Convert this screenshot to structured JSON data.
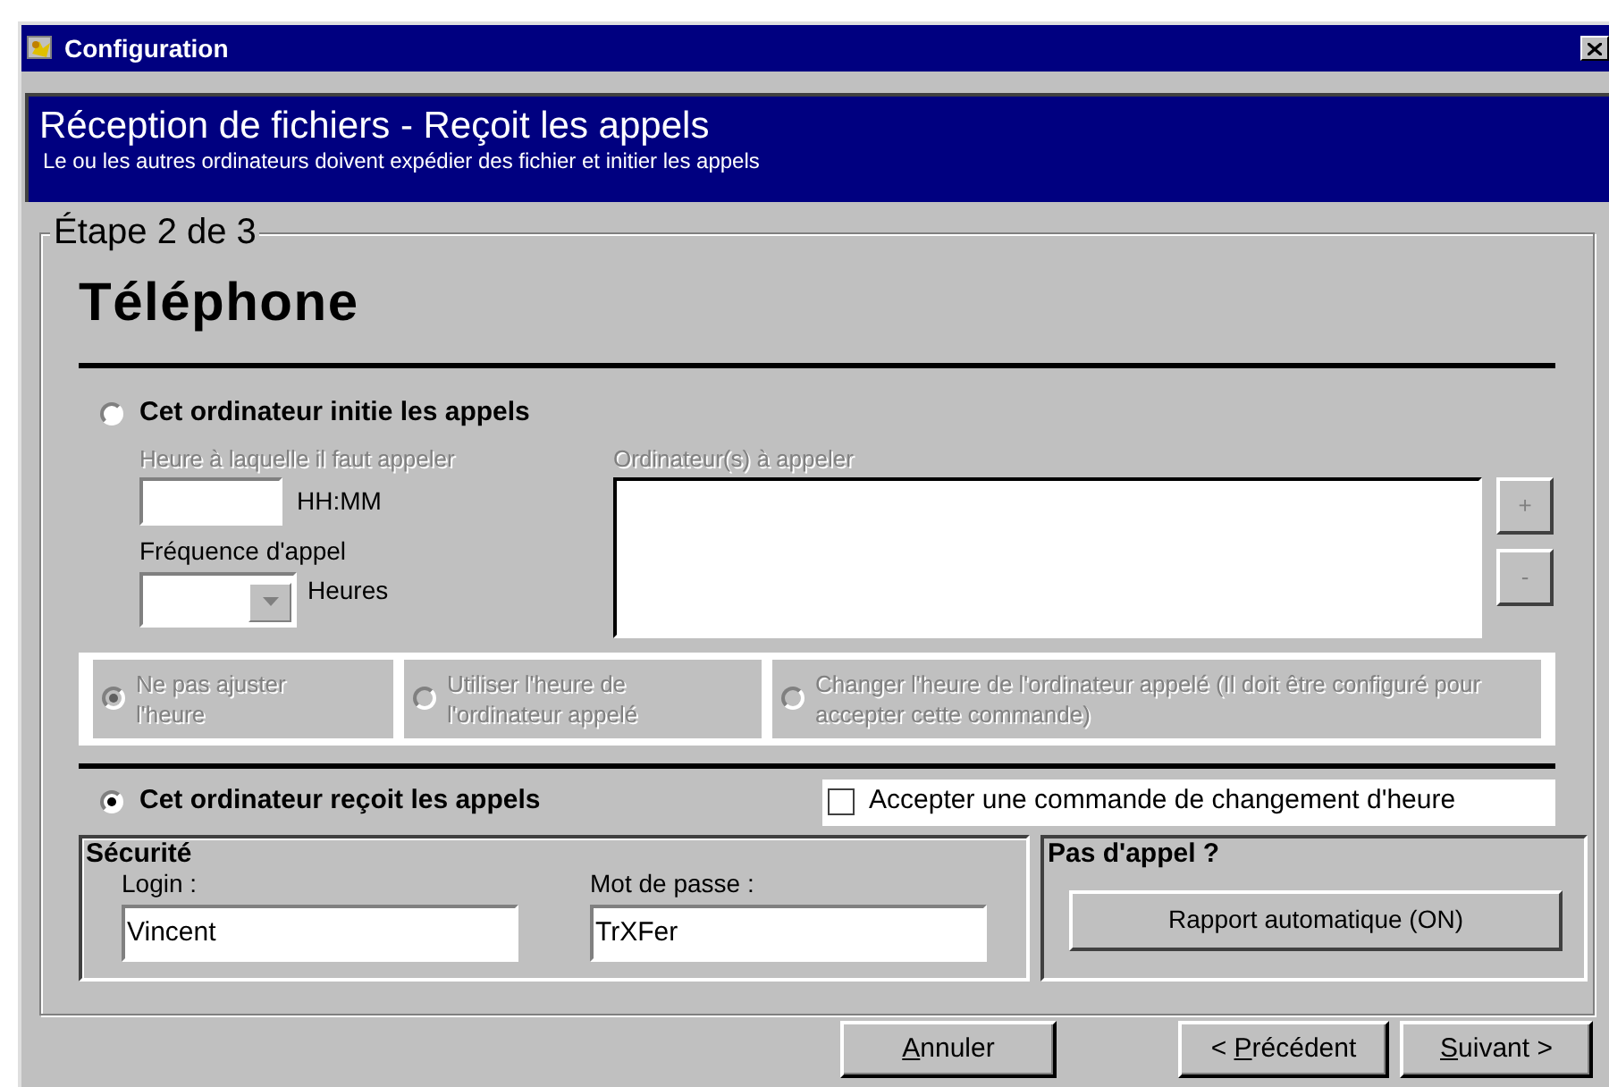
{
  "window": {
    "title": "Configuration"
  },
  "header": {
    "title": "Réception de fichiers - Reçoit les appels",
    "subtitle": "Le ou les autres ordinateurs doivent expédier des fichier et initier les appels"
  },
  "step": "Étape 2 de 3",
  "section_title": "Téléphone",
  "call_modes": [
    {
      "label": "Cet ordinateur initie les appels",
      "selected": false
    },
    {
      "label": "Cet ordinateur reçoit les appels",
      "selected": true
    }
  ],
  "call_time": {
    "label": "Heure à laquelle il faut appeler",
    "label_disabled": true,
    "unit": "HH:MM"
  },
  "frequency": {
    "label": "Fréquence d'appel",
    "unit": "Heures"
  },
  "computers": {
    "label": "Ordinateur(s) à appeler",
    "label_disabled": true,
    "buttons": [
      {
        "label": "+",
        "disabled": true
      },
      {
        "label": "-",
        "disabled": true
      }
    ]
  },
  "time_sync": [
    {
      "label": "Ne pas ajuster l'heure",
      "selected": true,
      "disabled": true
    },
    {
      "label": "Utiliser l'heure de l'ordinateur appelé",
      "selected": false,
      "disabled": true
    },
    {
      "label": "Changer l'heure de l'ordinateur appelé (Il doit être configuré pour accepter cette commande)",
      "selected": false,
      "disabled": true
    }
  ],
  "accept_time_change": {
    "label": "Accepter une commande de changement d'heure",
    "checked": false
  },
  "security": {
    "title": "Sécurité",
    "login": {
      "label": "Login :",
      "value": "Vincent"
    },
    "password": {
      "label": "Mot de passe :",
      "value": "TrXFer"
    }
  },
  "no_call": {
    "title": "Pas d'appel ?",
    "button": "Rapport automatique (ON)"
  },
  "buttons": [
    {
      "label": "Annuler"
    },
    {
      "label": "< Précédent"
    },
    {
      "label": "Suivant >"
    }
  ]
}
